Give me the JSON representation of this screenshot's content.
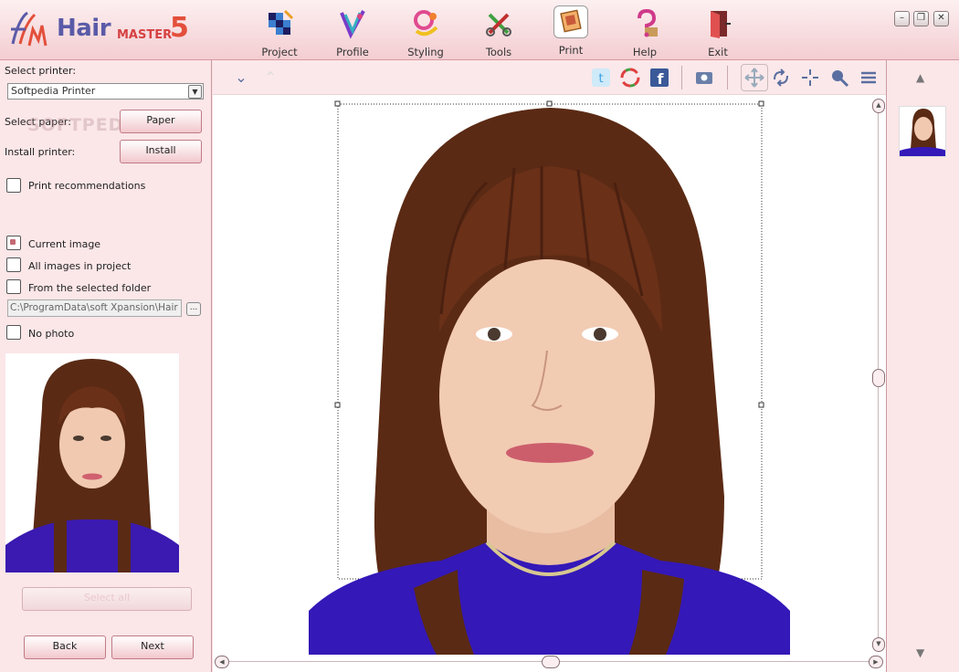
{
  "app": {
    "logo_text": "Hair",
    "logo_sub": "MASTER",
    "logo_version": "5"
  },
  "toolbar": {
    "items": [
      {
        "label": "Project",
        "icon": "project-icon"
      },
      {
        "label": "Profile",
        "icon": "profile-icon"
      },
      {
        "label": "Styling",
        "icon": "styling-icon"
      },
      {
        "label": "Tools",
        "icon": "tools-icon"
      },
      {
        "label": "Print",
        "icon": "print-icon",
        "active": true
      },
      {
        "label": "Help",
        "icon": "help-icon"
      },
      {
        "label": "Exit",
        "icon": "exit-icon"
      }
    ]
  },
  "left": {
    "select_printer_label": "Select printer:",
    "printer_value": "Softpedia Printer",
    "select_paper_label": "Select paper:",
    "paper_button": "Paper",
    "install_printer_label": "Install printer:",
    "install_button": "Install",
    "print_recommendations": "Print recommendations",
    "current_image": "Current image",
    "all_images": "All images in project",
    "from_folder": "From the selected folder",
    "folder_path": "C:\\ProgramData\\soft Xpansion\\Hair Ma",
    "browse": "...",
    "no_photo": "No photo",
    "select_all": "Select all",
    "back": "Back",
    "next": "Next",
    "watermark": "SOFTPEDIA"
  },
  "colors": {
    "accent": "#c46a74",
    "panel_bg": "#fbe6e8",
    "header_bg": "#f3cdd1",
    "logo_blue": "#5a5aa8",
    "logo_red": "#e34f3b"
  }
}
